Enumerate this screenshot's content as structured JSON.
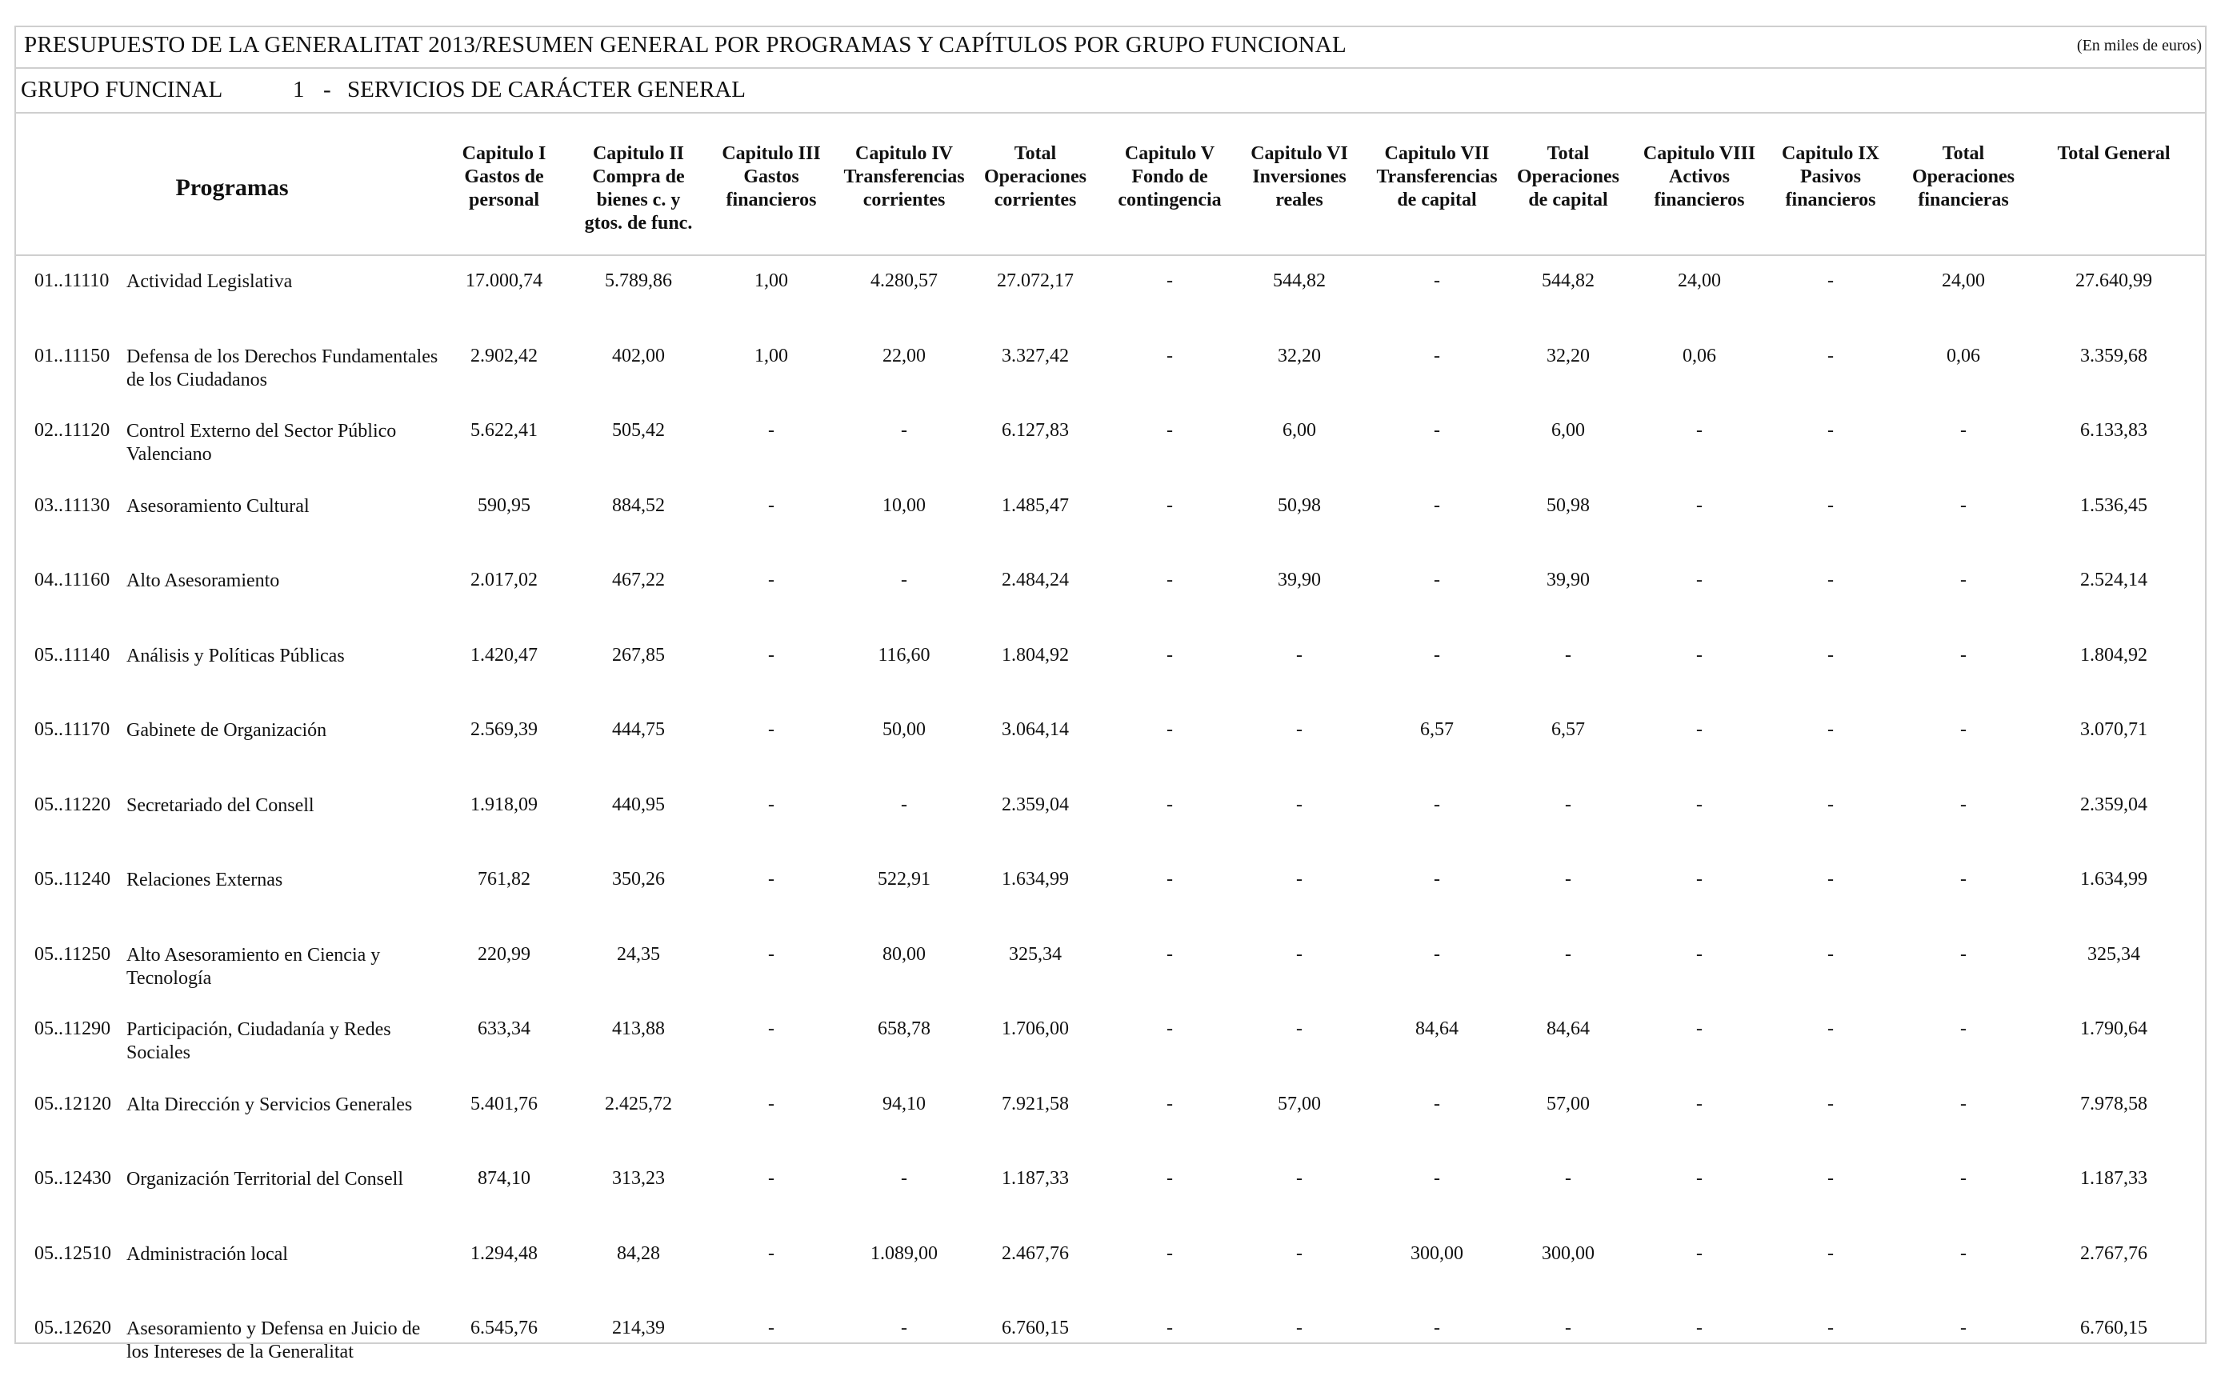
{
  "document": {
    "title": "PRESUPUESTO DE LA GENERALITAT 2013/RESUMEN GENERAL POR PROGRAMAS Y CAPÍTULOS POR GRUPO FUNCIONAL",
    "units": "(En miles de euros)"
  },
  "group": {
    "label": "GRUPO FUNCINAL",
    "number": "1",
    "dash": "-",
    "name": "SERVICIOS DE CARÁCTER GENERAL"
  },
  "table": {
    "programs_header": "Programas",
    "columns": [
      "Capitulo I\nGastos de\npersonal",
      "Capitulo II\nCompra de\nbienes c. y\ngtos. de func.",
      "Capitulo III\nGastos\nfinancieros",
      "Capitulo IV\nTransferencias\ncorrientes",
      "Total\nOperaciones\ncorrientes",
      "Capitulo V\nFondo de\ncontingencia",
      "Capitulo VI\nInversiones\nreales",
      "Capitulo VII\nTransferencias\nde capital",
      "Total\nOperaciones\nde capital",
      "Capitulo VIII\nActivos\nfinancieros",
      "Capitulo IX\nPasivos\nfinancieros",
      "Total\nOperaciones\nfinancieras",
      "Total General"
    ],
    "rows": [
      {
        "code": "01..11110",
        "name": "Actividad Legislativa",
        "values": [
          "17.000,74",
          "5.789,86",
          "1,00",
          "4.280,57",
          "27.072,17",
          "-",
          "544,82",
          "-",
          "544,82",
          "24,00",
          "-",
          "24,00",
          "27.640,99"
        ]
      },
      {
        "code": "01..11150",
        "name": "Defensa de los Derechos Fundamentales de los Ciudadanos",
        "values": [
          "2.902,42",
          "402,00",
          "1,00",
          "22,00",
          "3.327,42",
          "-",
          "32,20",
          "-",
          "32,20",
          "0,06",
          "-",
          "0,06",
          "3.359,68"
        ]
      },
      {
        "code": "02..11120",
        "name": "Control Externo del Sector Público Valenciano",
        "values": [
          "5.622,41",
          "505,42",
          "-",
          "-",
          "6.127,83",
          "-",
          "6,00",
          "-",
          "6,00",
          "-",
          "-",
          "-",
          "6.133,83"
        ]
      },
      {
        "code": "03..11130",
        "name": "Asesoramiento Cultural",
        "values": [
          "590,95",
          "884,52",
          "-",
          "10,00",
          "1.485,47",
          "-",
          "50,98",
          "-",
          "50,98",
          "-",
          "-",
          "-",
          "1.536,45"
        ]
      },
      {
        "code": "04..11160",
        "name": "Alto Asesoramiento",
        "values": [
          "2.017,02",
          "467,22",
          "-",
          "-",
          "2.484,24",
          "-",
          "39,90",
          "-",
          "39,90",
          "-",
          "-",
          "-",
          "2.524,14"
        ]
      },
      {
        "code": "05..11140",
        "name": "Análisis y Políticas Públicas",
        "values": [
          "1.420,47",
          "267,85",
          "-",
          "116,60",
          "1.804,92",
          "-",
          "-",
          "-",
          "-",
          "-",
          "-",
          "-",
          "1.804,92"
        ]
      },
      {
        "code": "05..11170",
        "name": "Gabinete de Organización",
        "values": [
          "2.569,39",
          "444,75",
          "-",
          "50,00",
          "3.064,14",
          "-",
          "-",
          "6,57",
          "6,57",
          "-",
          "-",
          "-",
          "3.070,71"
        ]
      },
      {
        "code": "05..11220",
        "name": "Secretariado del Consell",
        "values": [
          "1.918,09",
          "440,95",
          "-",
          "-",
          "2.359,04",
          "-",
          "-",
          "-",
          "-",
          "-",
          "-",
          "-",
          "2.359,04"
        ]
      },
      {
        "code": "05..11240",
        "name": "Relaciones Externas",
        "values": [
          "761,82",
          "350,26",
          "-",
          "522,91",
          "1.634,99",
          "-",
          "-",
          "-",
          "-",
          "-",
          "-",
          "-",
          "1.634,99"
        ]
      },
      {
        "code": "05..11250",
        "name": "Alto Asesoramiento en Ciencia y Tecnología",
        "values": [
          "220,99",
          "24,35",
          "-",
          "80,00",
          "325,34",
          "-",
          "-",
          "-",
          "-",
          "-",
          "-",
          "-",
          "325,34"
        ]
      },
      {
        "code": "05..11290",
        "name": "Participación, Ciudadanía y Redes Sociales",
        "values": [
          "633,34",
          "413,88",
          "-",
          "658,78",
          "1.706,00",
          "-",
          "-",
          "84,64",
          "84,64",
          "-",
          "-",
          "-",
          "1.790,64"
        ]
      },
      {
        "code": "05..12120",
        "name": "Alta Dirección y Servicios Generales",
        "values": [
          "5.401,76",
          "2.425,72",
          "-",
          "94,10",
          "7.921,58",
          "-",
          "57,00",
          "-",
          "57,00",
          "-",
          "-",
          "-",
          "7.978,58"
        ]
      },
      {
        "code": "05..12430",
        "name": "Organización Territorial del Consell",
        "values": [
          "874,10",
          "313,23",
          "-",
          "-",
          "1.187,33",
          "-",
          "-",
          "-",
          "-",
          "-",
          "-",
          "-",
          "1.187,33"
        ]
      },
      {
        "code": "05..12510",
        "name": " Administración local",
        "values": [
          "1.294,48",
          "84,28",
          "-",
          "1.089,00",
          "2.467,76",
          "-",
          "-",
          "300,00",
          "300,00",
          "-",
          "-",
          "-",
          "2.767,76"
        ]
      },
      {
        "code": "05..12620",
        "name": "Asesoramiento y Defensa en Juicio de los Intereses de la Generalitat",
        "values": [
          "6.545,76",
          "214,39",
          "-",
          "-",
          "6.760,15",
          "-",
          "-",
          "-",
          "-",
          "-",
          "-",
          "-",
          "6.760,15"
        ]
      }
    ]
  }
}
